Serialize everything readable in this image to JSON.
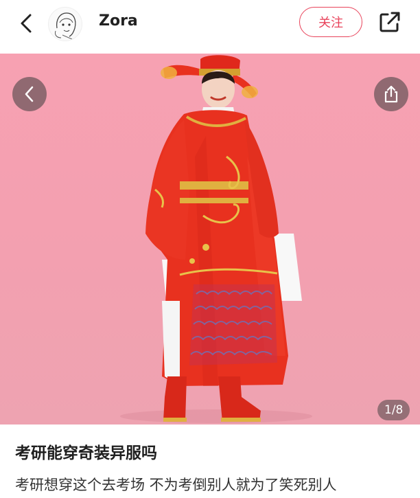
{
  "header": {
    "author_name": "Zora",
    "follow_label": "关注"
  },
  "gallery": {
    "counter": "1/8",
    "current": 1,
    "total": 8
  },
  "post": {
    "title": "考研能穿奇装异服吗",
    "body": "考研想穿这个去考场 不为考倒别人就为了笑死别人"
  },
  "colors": {
    "accent": "#e8425a",
    "photo_background": "#f3a0b0",
    "robe": "#e8311f"
  },
  "icons": {
    "back": "chevron-left-icon",
    "share": "share-icon",
    "image_prev": "chevron-left-icon",
    "image_share": "share-icon"
  }
}
